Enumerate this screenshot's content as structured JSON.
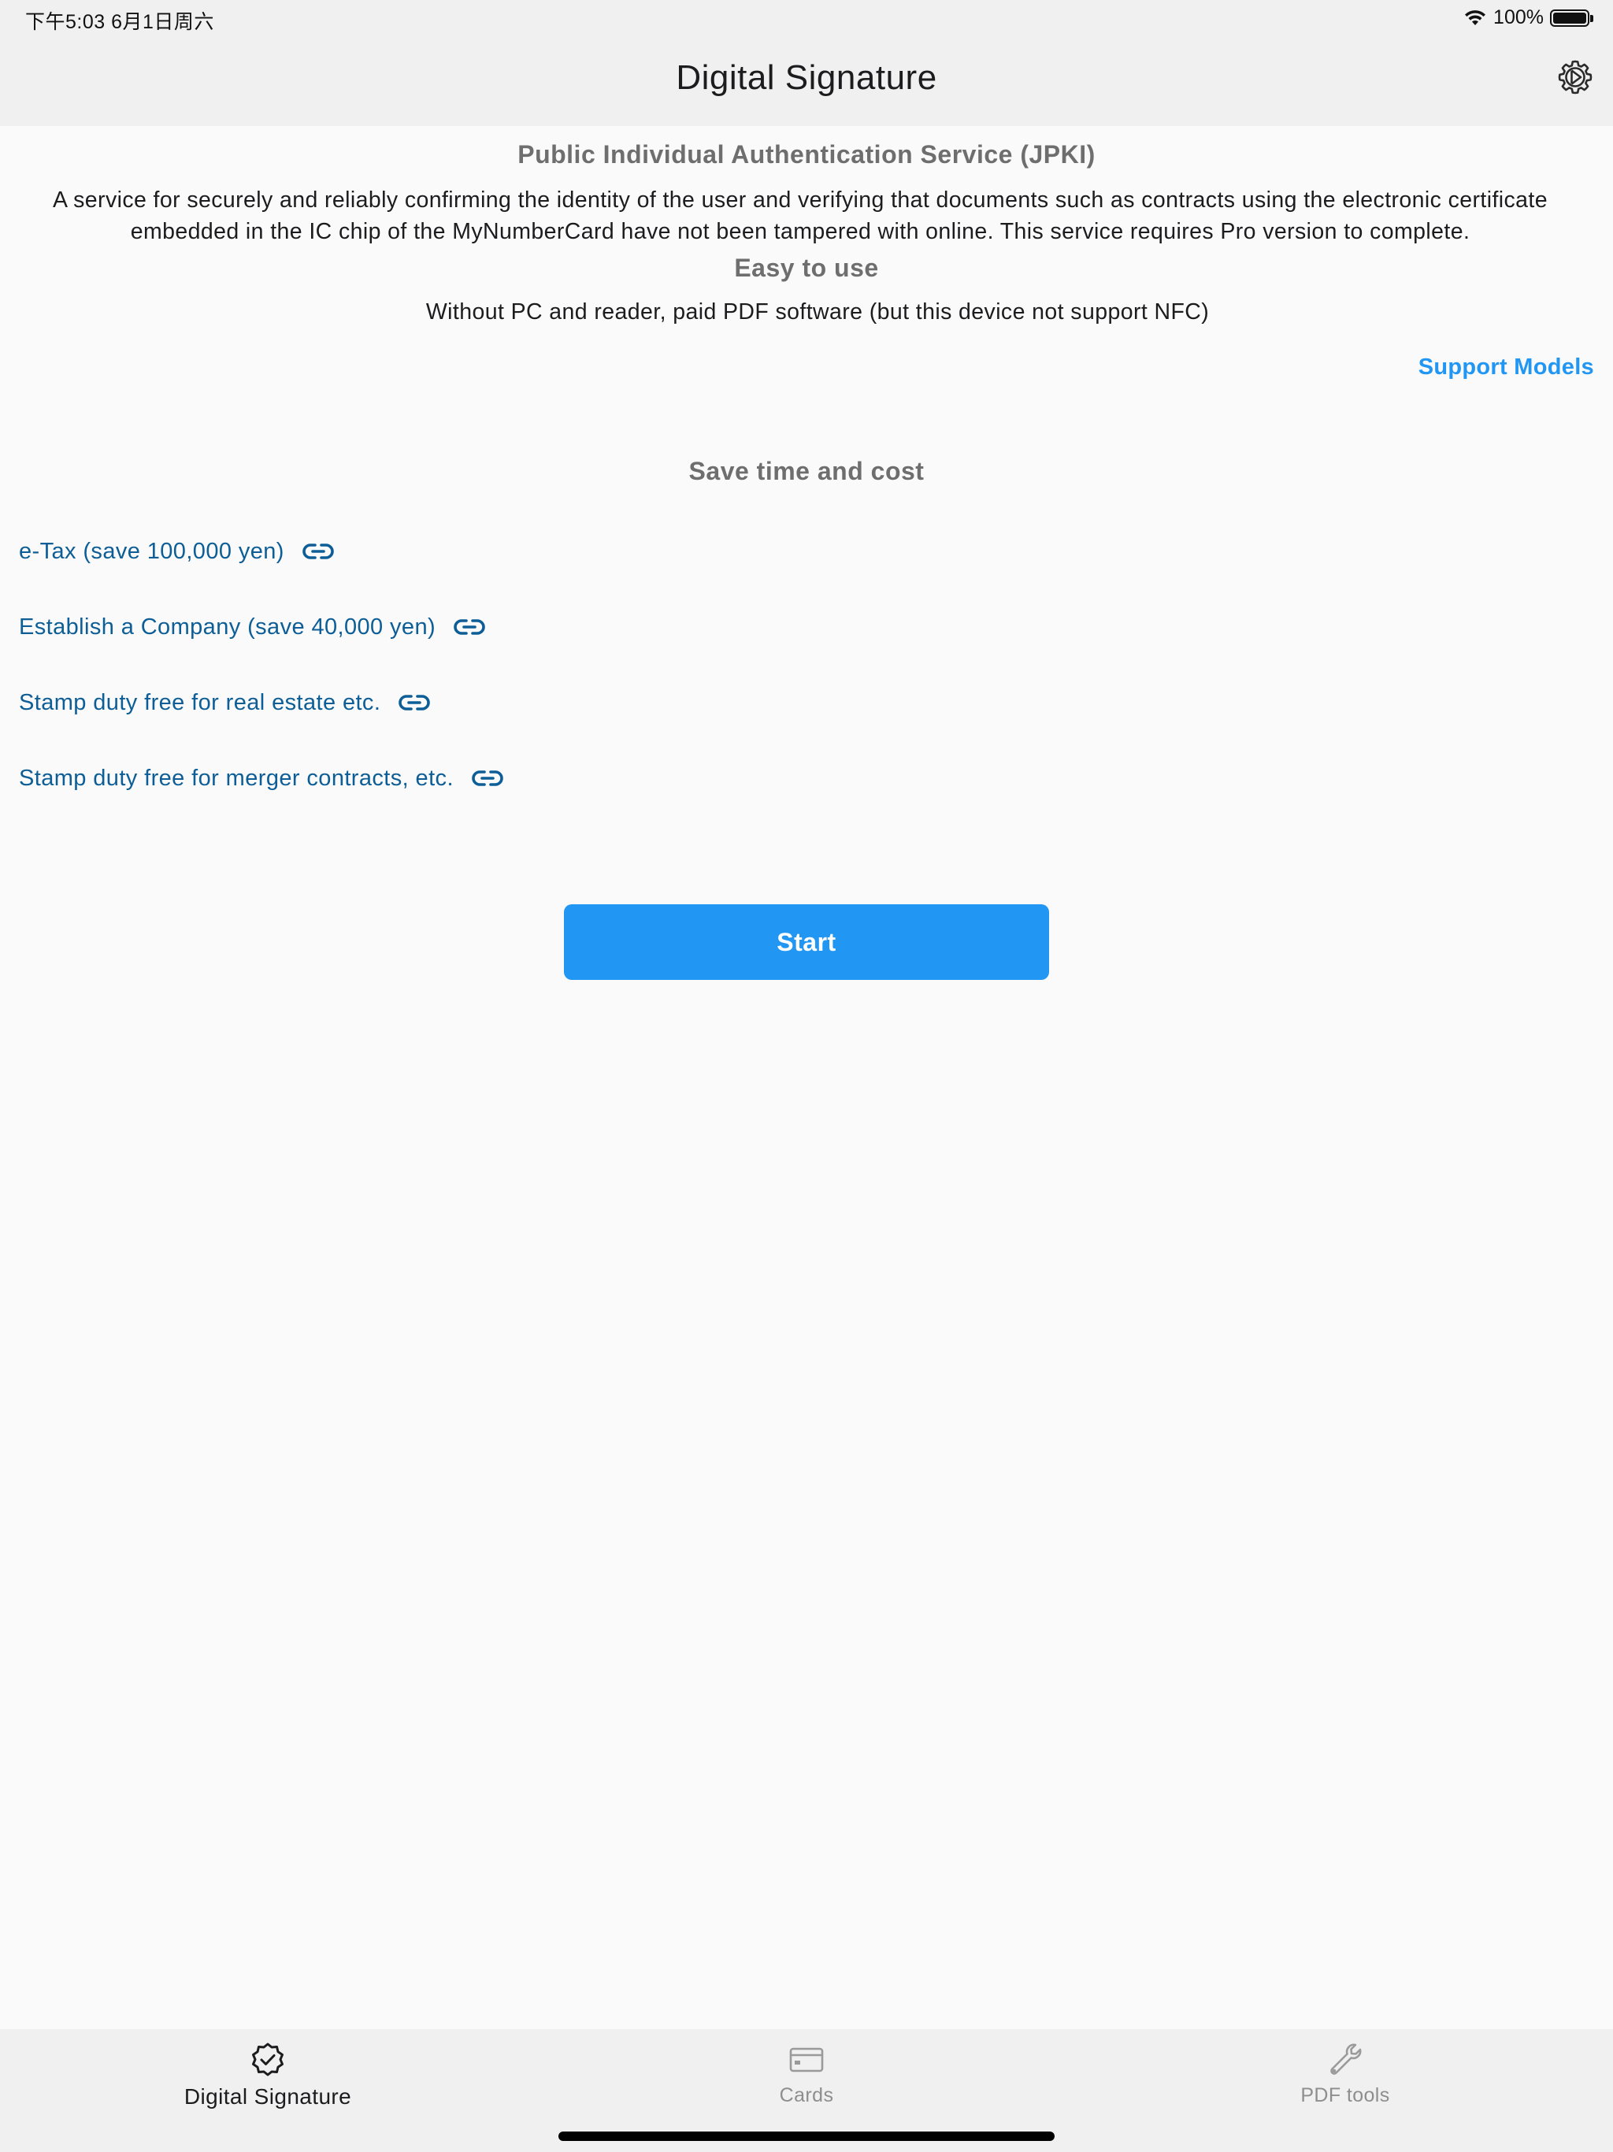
{
  "status_bar": {
    "time": "下午5:03   6月1日周六",
    "battery": "100%",
    "battery_level": 1.0,
    "icons": [
      "wifi-icon",
      "battery-icon"
    ]
  },
  "nav": {
    "title": "Digital Signature",
    "settings_icon": "gear-icon"
  },
  "content": {
    "jpki_heading": "Public Individual Authentication Service (JPKI)",
    "intro": "A service for securely and reliably confirming the identity of the user and verifying that documents such as contracts using the electronic certificate embedded in the IC chip of the MyNumberCard have not been tampered with online. This service requires Pro version to complete.",
    "easy_heading": "Easy to use",
    "easy_text": "Without PC and reader, paid PDF software (but this device not support NFC)",
    "support_link": "Support Models",
    "save_heading": "Save time and cost",
    "links": [
      {
        "label": "e-Tax (save 100,000 yen)",
        "icon": "link-icon"
      },
      {
        "label": "Establish a Company (save 40,000 yen)",
        "icon": "link-icon"
      },
      {
        "label": "Stamp duty free for real estate etc.",
        "icon": "link-icon"
      },
      {
        "label": "Stamp duty free for merger contracts, etc.",
        "icon": "link-icon"
      }
    ],
    "start_button": "Start"
  },
  "tabbar": {
    "tabs": [
      {
        "label": "Digital Signature",
        "icon": "verified-badge-icon",
        "active": true
      },
      {
        "label": "Cards",
        "icon": "card-icon",
        "active": false
      },
      {
        "label": "PDF tools",
        "icon": "wrench-icon",
        "active": false
      }
    ]
  },
  "colors": {
    "accent": "#2196f3",
    "link": "#0d5e96",
    "bar_background": "#f0f0f0",
    "page_background": "#fafafa",
    "heading_gray": "#6e6e6e"
  }
}
